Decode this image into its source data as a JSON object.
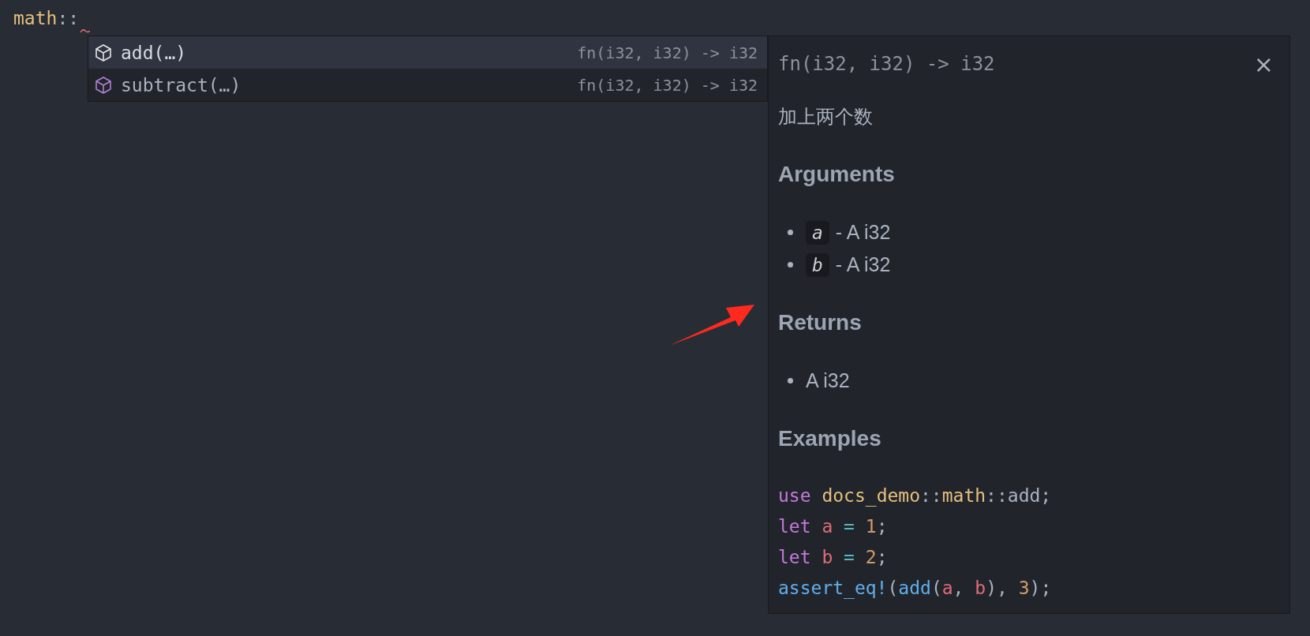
{
  "editor": {
    "line": [
      {
        "kind": "module",
        "text": "math"
      },
      {
        "kind": "punct",
        "text": "::"
      }
    ]
  },
  "completions": [
    {
      "label": "add(…)",
      "detail": "fn(i32, i32) -> i32",
      "selected": true
    },
    {
      "label": "subtract(…)",
      "detail": "fn(i32, i32) -> i32",
      "selected": false
    }
  ],
  "docs": {
    "signature": "fn(i32, i32) -> i32",
    "close": "×",
    "summary": "加上两个数",
    "sections": [
      {
        "heading": "Arguments",
        "items": [
          {
            "code": "a",
            "text": "- A i32"
          },
          {
            "code": "b",
            "text": "- A i32"
          }
        ]
      },
      {
        "heading": "Returns",
        "items": [
          {
            "text": "A i32"
          }
        ]
      },
      {
        "heading": "Examples",
        "code_lines": [
          [
            {
              "kind": "keyword",
              "text": "use "
            },
            {
              "kind": "module",
              "text": "docs_demo"
            },
            {
              "kind": "punct",
              "text": "::"
            },
            {
              "kind": "module",
              "text": "math"
            },
            {
              "kind": "punct",
              "text": "::add;"
            }
          ],
          [
            {
              "kind": "keyword",
              "text": "let "
            },
            {
              "kind": "variable",
              "text": "a "
            },
            {
              "kind": "operator",
              "text": "= "
            },
            {
              "kind": "number",
              "text": "1"
            },
            {
              "kind": "punct",
              "text": ";"
            }
          ],
          [
            {
              "kind": "keyword",
              "text": "let "
            },
            {
              "kind": "variable",
              "text": "b "
            },
            {
              "kind": "operator",
              "text": "= "
            },
            {
              "kind": "number",
              "text": "2"
            },
            {
              "kind": "punct",
              "text": ";"
            }
          ],
          [
            {
              "kind": "function",
              "text": "assert_eq!"
            },
            {
              "kind": "punct",
              "text": "("
            },
            {
              "kind": "function",
              "text": "add"
            },
            {
              "kind": "punct",
              "text": "("
            },
            {
              "kind": "variable",
              "text": "a"
            },
            {
              "kind": "punct",
              "text": ", "
            },
            {
              "kind": "variable",
              "text": "b"
            },
            {
              "kind": "punct",
              "text": "), "
            },
            {
              "kind": "number",
              "text": "3"
            },
            {
              "kind": "punct",
              "text": ");"
            }
          ]
        ]
      }
    ]
  }
}
